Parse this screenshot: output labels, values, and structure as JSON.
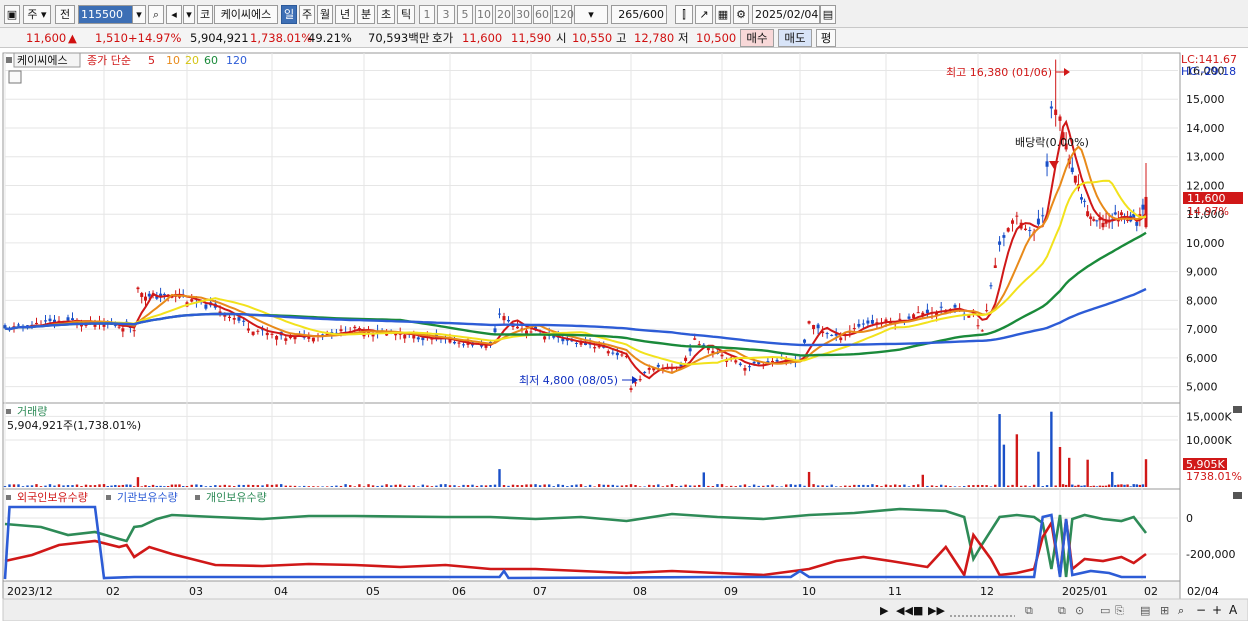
{
  "toolbar": {
    "market_code": "주",
    "prev_label": "전",
    "stock_code": "115500",
    "kor_label": "코",
    "stock_name": "케이씨에스",
    "periods": [
      "일",
      "주",
      "월",
      "년",
      "분",
      "초",
      "틱"
    ],
    "period_selected": "일",
    "intervals": [
      "1",
      "3",
      "5",
      "10",
      "20",
      "30",
      "60",
      "120"
    ],
    "count_value": "265",
    "count_total": "/600",
    "date_value": "2025/02/04"
  },
  "info": {
    "price": "11,600",
    "change_arrow": "▲",
    "change": "1,510",
    "change_pct": "+14.97%",
    "volume": "5,904,921",
    "volume_pct": "1,738.01%",
    "turnover_pct": "49.21%",
    "trade_value": "70,593백만",
    "quote_label": "호가",
    "ask": "11,600",
    "bid": "11,590",
    "open_label": "시",
    "open": "10,550",
    "high_label": "고",
    "high": "12,780",
    "low_label": "저",
    "low": "10,500",
    "buy_label": "매수",
    "sell_label": "매도",
    "flat_label": "평"
  },
  "price_panel": {
    "stock_tag": "케이씨에스",
    "ma_label": "종가 단순",
    "ma_periods": [
      "5",
      "10",
      "20",
      "60",
      "120"
    ],
    "ma_colors": [
      "#d01818",
      "#e88a1a",
      "#f2e21c",
      "#1a8a3a",
      "#2d5cd6"
    ],
    "lc_label": "LC:141.67",
    "hc_label": "HC:-29.18",
    "high_annotation": "최고 16,380 (01/06)",
    "low_annotation": "최저 4,800 (08/05)",
    "dividend_annotation": "배당락(0.00%)",
    "current_price_label": "11,600",
    "current_pct_label": "14.97%",
    "y_ticks": [
      "16,000",
      "15,000",
      "14,000",
      "13,000",
      "12,000",
      "11,000",
      "10,000",
      "9,000",
      "8,000",
      "7,000",
      "6,000",
      "5,000"
    ]
  },
  "volume_panel": {
    "title": "거래량",
    "value_text": "5,904,921주(1,738.01%)",
    "y_ticks": [
      "15,000K",
      "10,000K"
    ],
    "current_label": "5,905K",
    "current_pct": "1738.01%"
  },
  "holdings_panel": {
    "series": [
      "외국인보유수량",
      "기관보유수량",
      "개인보유수량"
    ],
    "series_colors": [
      "#d01818",
      "#2d5cd6",
      "#2e8b57"
    ],
    "y_ticks": [
      "0",
      "-200,000"
    ]
  },
  "x_axis": {
    "labels": [
      "2023/12",
      "02",
      "03",
      "04",
      "05",
      "06",
      "07",
      "08",
      "09",
      "10",
      "11",
      "12",
      "2025/01",
      "02"
    ],
    "right_label": "02/04"
  },
  "chart_data": {
    "type": "candlestick",
    "y_range": [
      4500,
      16400
    ],
    "high": {
      "value": 16380,
      "date": "01/06"
    },
    "low": {
      "value": 4800,
      "date": "08/05"
    },
    "last": {
      "open": 10550,
      "high": 12780,
      "low": 10500,
      "close": 11600
    }
  }
}
